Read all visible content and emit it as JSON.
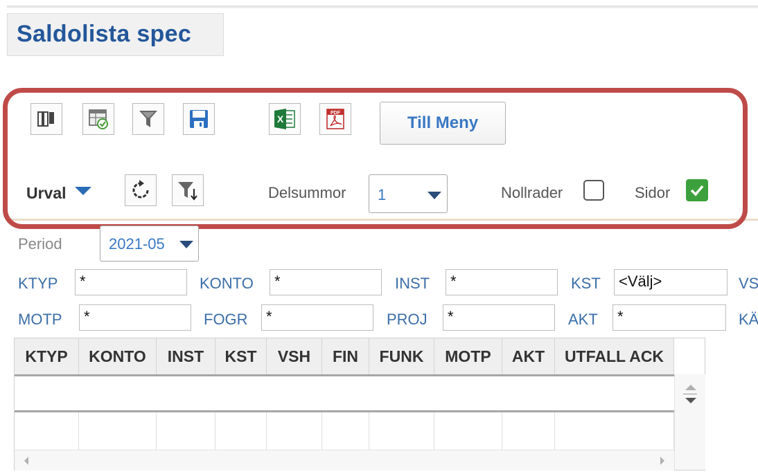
{
  "header": {
    "title": "Saldolista spec"
  },
  "toolbar": {
    "icons": [
      "columns-icon",
      "table-check-icon",
      "filter-icon",
      "save-icon",
      "excel-icon",
      "pdf-icon"
    ],
    "pdf_text": "PDF",
    "excel_text": "X",
    "till_meny_label": "Till Meny"
  },
  "urval": {
    "label": "Urval",
    "delsummor_label": "Delsummor",
    "delsummor_value": "1",
    "nollrader_label": "Nollrader",
    "nollrader_checked": false,
    "sidor_label": "Sidor",
    "sidor_checked": true
  },
  "filters": {
    "period_label": "Period",
    "period_value": "2021-05",
    "row1": [
      {
        "label": "KTYP",
        "value": "*"
      },
      {
        "label": "KONTO",
        "value": "*"
      },
      {
        "label": "INST",
        "value": "*"
      },
      {
        "label": "KST",
        "value": "<Välj>"
      },
      {
        "label": "VS",
        "value": ""
      }
    ],
    "row2": [
      {
        "label": "MOTP",
        "value": "*"
      },
      {
        "label": "FOGR",
        "value": "*"
      },
      {
        "label": "PROJ",
        "value": "*"
      },
      {
        "label": "AKT",
        "value": "*"
      },
      {
        "label": "KÄ",
        "value": ""
      }
    ]
  },
  "grid": {
    "columns": [
      "KTYP",
      "KONTO",
      "INST",
      "KST",
      "VSH",
      "FIN",
      "FUNK",
      "MOTP",
      "AKT",
      "UTFALL ACK"
    ]
  },
  "colors": {
    "title": "#24579a",
    "highlight_border": "#be4b48",
    "link_blue": "#3a78c4",
    "check_green": "#3ca03c"
  }
}
